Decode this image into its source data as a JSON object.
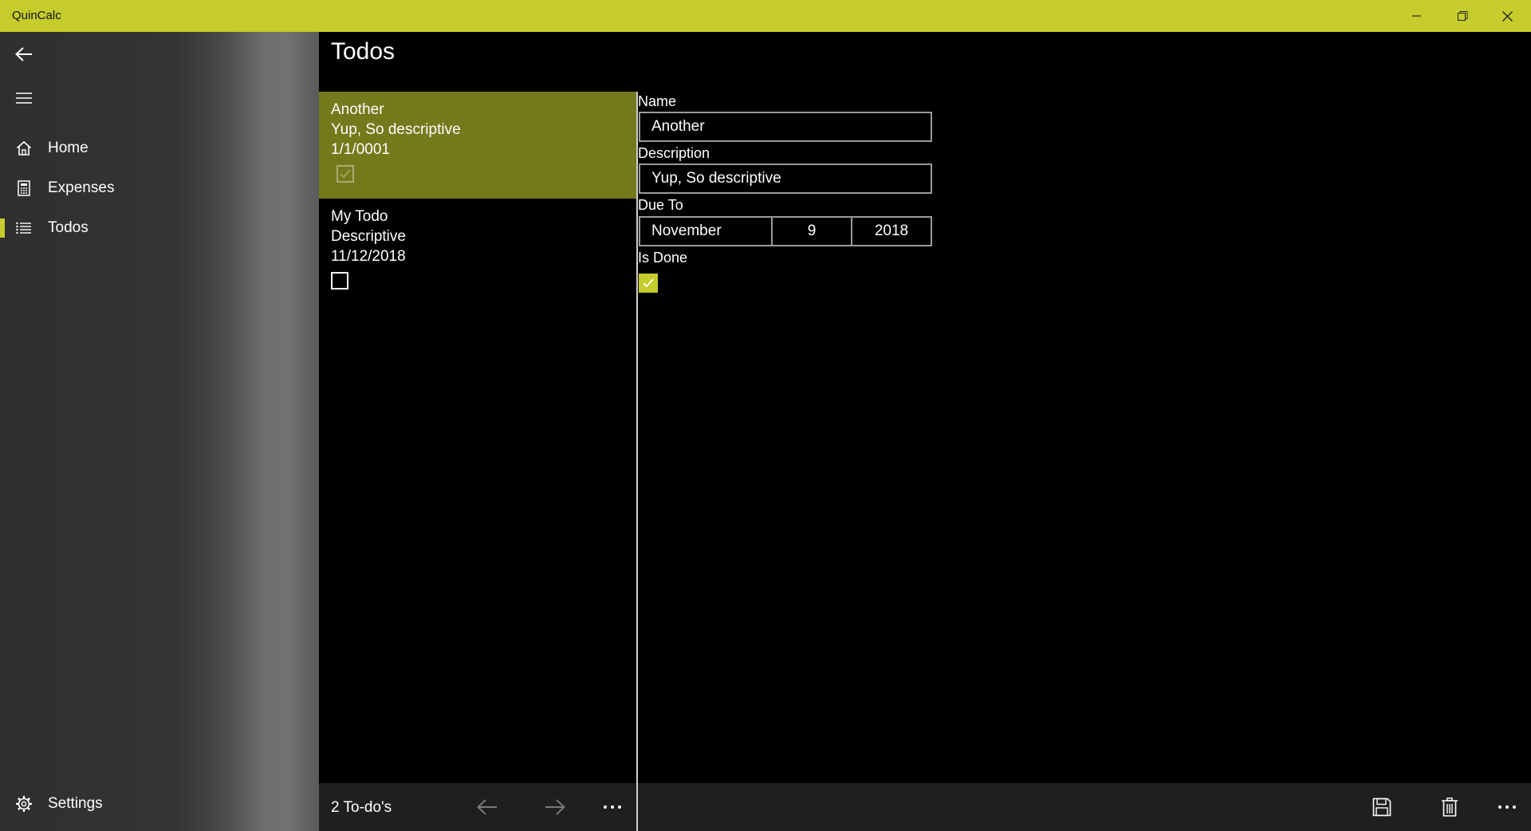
{
  "window": {
    "title": "QuinCalc",
    "accent_color": "#c6cc2b",
    "controls": [
      "minimize-icon",
      "restore-icon",
      "close-icon"
    ]
  },
  "nav": {
    "back_icon": "back-arrow-icon",
    "menu_icon": "hamburger-icon",
    "items": [
      {
        "label": "Home",
        "icon": "home-icon",
        "selected": false
      },
      {
        "label": "Expenses",
        "icon": "calculator-icon",
        "selected": false
      },
      {
        "label": "Todos",
        "icon": "list-icon",
        "selected": true
      }
    ],
    "settings": {
      "label": "Settings",
      "icon": "gear-icon"
    }
  },
  "page": {
    "title": "Todos"
  },
  "todos": [
    {
      "name": "Another",
      "description": "Yup, So descriptive",
      "date": "1/1/0001",
      "done": true,
      "selected": true
    },
    {
      "name": "My Todo",
      "description": "Descriptive",
      "date": "11/12/2018",
      "done": false,
      "selected": false
    }
  ],
  "detail": {
    "name_label": "Name",
    "name_value": "Another",
    "description_label": "Description",
    "description_value": "Yup, So descriptive",
    "due_label": "Due To",
    "due_month": "November",
    "due_day": "9",
    "due_year": "2018",
    "done_label": "Is Done",
    "done_value": true
  },
  "list_commands": {
    "count_text": "2 To-do's",
    "buttons": [
      "prev-arrow-icon",
      "next-arrow-icon",
      "more-icon"
    ]
  },
  "detail_commands": {
    "buttons": [
      "save-icon",
      "delete-icon",
      "more-icon"
    ]
  }
}
